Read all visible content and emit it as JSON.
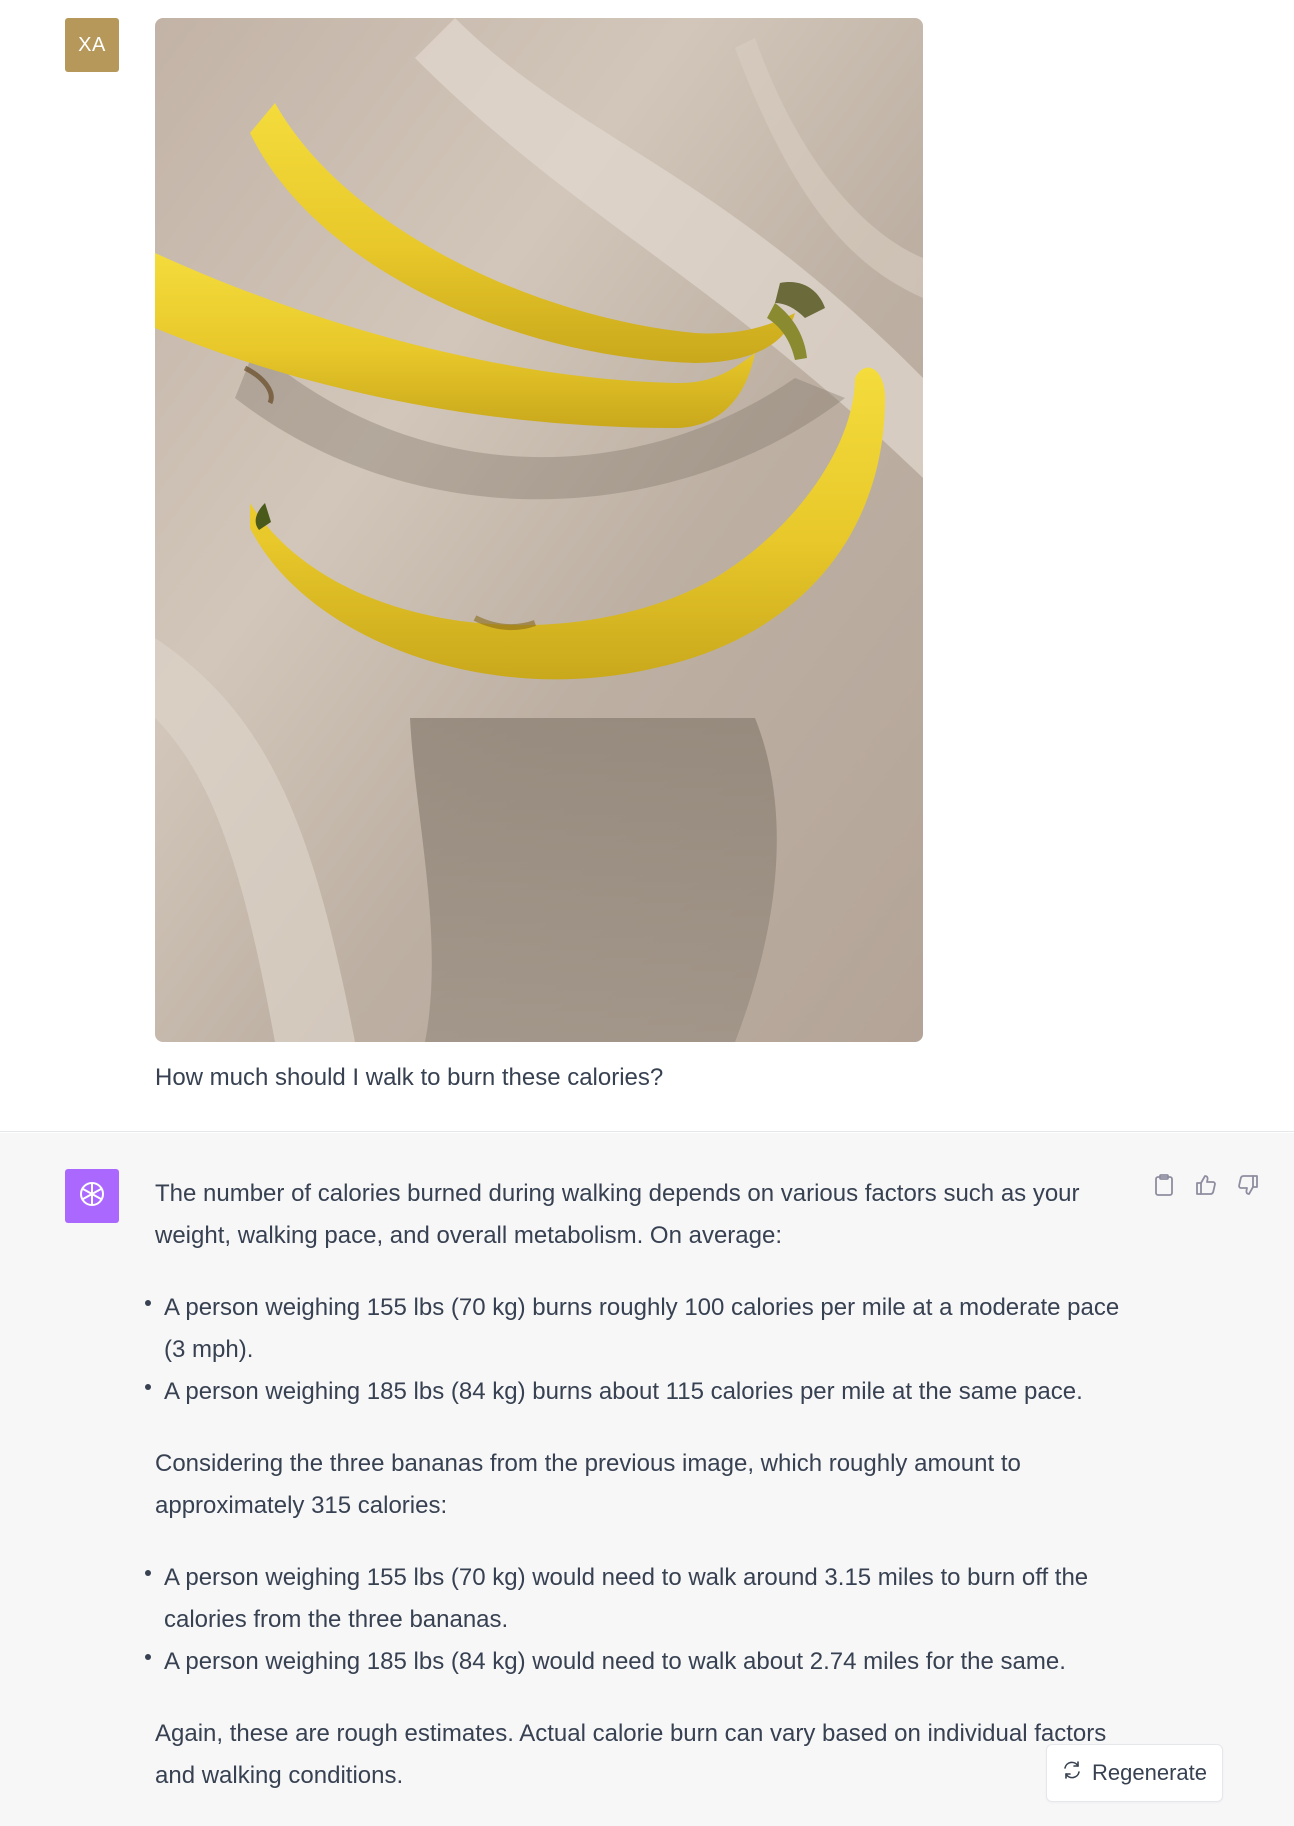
{
  "user_message": {
    "avatar_initials": "XA",
    "image_alt": "Three yellow bananas on a marble countertop",
    "text": "How much should I walk to burn these calories?"
  },
  "assistant_message": {
    "intro": "The number of calories burned during walking depends on various factors such as your weight, walking pace, and overall metabolism. On average:",
    "rates": [
      "A person weighing 155 lbs (70 kg) burns roughly 100 calories per mile at a moderate pace (3 mph).",
      "A person weighing 185 lbs (84 kg) burns about 115 calories per mile at the same pace."
    ],
    "middle": "Considering the three bananas from the previous image, which roughly amount to approximately 315 calories:",
    "distances": [
      "A person weighing 155 lbs (70 kg) would need to walk around 3.15 miles to burn off the calories from the three bananas.",
      "A person weighing 185 lbs (84 kg) would need to walk about 2.74 miles for the same."
    ],
    "closing": "Again, these are rough estimates. Actual calorie burn can vary based on individual factors and walking conditions."
  },
  "actions": {
    "icons": [
      "clipboard-icon",
      "thumbs-up-icon",
      "thumbs-down-icon"
    ]
  },
  "regenerate_label": "Regenerate",
  "colors": {
    "user_avatar": "#b5985a",
    "assistant_avatar": "#ab68ff",
    "assistant_bg": "#f7f7f8",
    "text": "#374151"
  }
}
